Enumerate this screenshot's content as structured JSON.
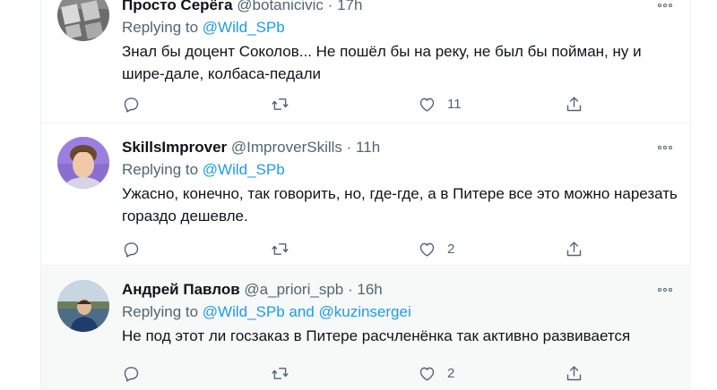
{
  "tweets": [
    {
      "name": "Просто Серёга",
      "handle": "@botanicivic",
      "separator": "·",
      "time": "17h",
      "replying_prefix": "Replying to ",
      "mentions": "@Wild_SPb",
      "text": "Знал бы доцент Соколов... Не пошёл бы на реку, не был бы пойман, ну и шире-дале, колбаса-педали",
      "likes": "11"
    },
    {
      "name": "SkillsImprover",
      "handle": "@ImproverSkills",
      "separator": "·",
      "time": "11h",
      "replying_prefix": "Replying to ",
      "mentions": "@Wild_SPb",
      "text": "Ужасно, конечно, так говорить, но, где-где, а в Питере все это можно нарезать гораздо дешевле.",
      "likes": "2"
    },
    {
      "name": "Андрей Павлов",
      "handle": "@a_priori_spb",
      "separator": "·",
      "time": "16h",
      "replying_prefix": "Replying to ",
      "mentions": "@Wild_SPb and @kuzinsergei",
      "text": "Не под этот ли госзаказ в Питере расчленёнка так активно развивается",
      "likes": "2"
    }
  ],
  "icons": {
    "more": "more-dots-icon",
    "reply": "reply-bubble-icon",
    "retweet": "retweet-icon",
    "like": "heart-icon",
    "share": "share-upload-icon"
  },
  "colors": {
    "link": "#1d9bf0",
    "secondary_text": "#536471",
    "primary_text": "#0f1419",
    "hover_row": "#f7f9f9"
  }
}
